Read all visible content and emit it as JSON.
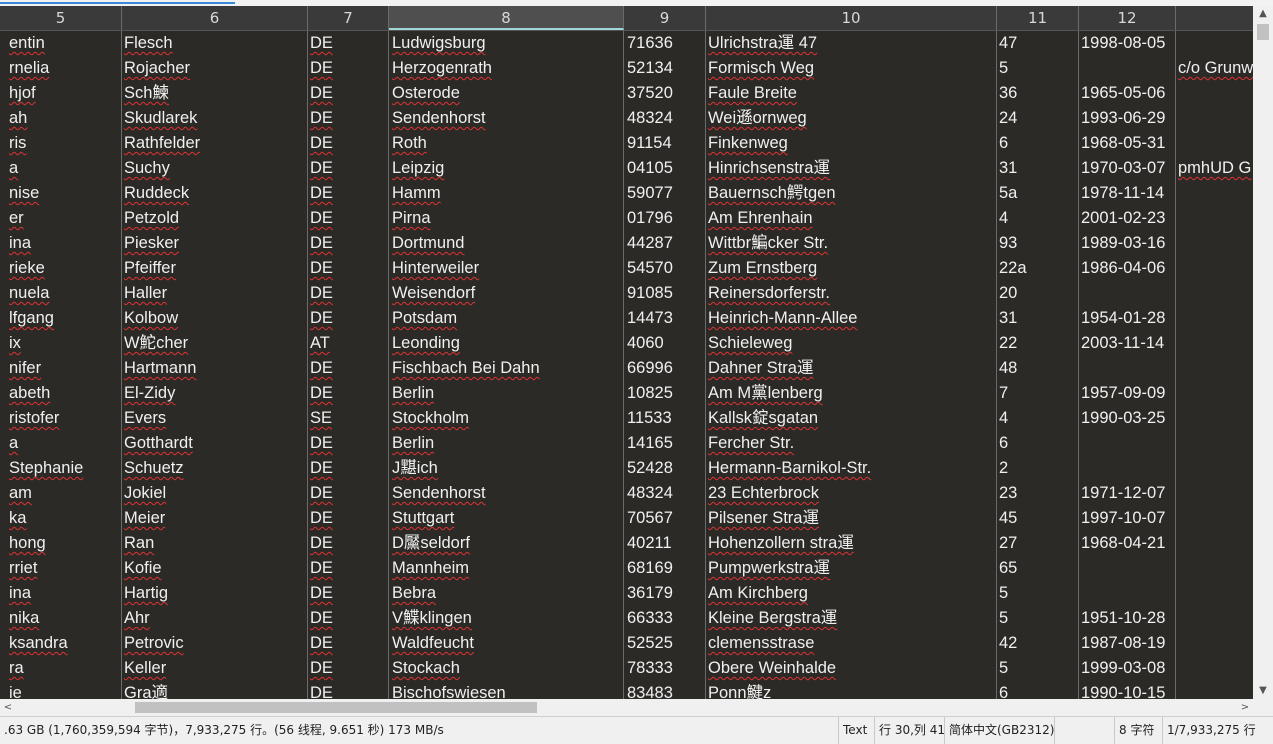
{
  "header": {
    "columns": [
      "5",
      "6",
      "7",
      "8",
      "9",
      "10",
      "11",
      "12",
      ""
    ]
  },
  "rows": [
    [
      "entin",
      "Flesch",
      "DE",
      "Ludwigsburg",
      "71636",
      "Ulrichstra運 47",
      "47",
      "1998-08-05",
      ""
    ],
    [
      "rnelia",
      "Rojacher",
      "DE",
      "Herzogenrath",
      "52134",
      "Formisch Weg",
      "5",
      "",
      "c/o Grunw"
    ],
    [
      "hjof",
      "Sch鰊",
      "DE",
      "Osterode",
      "37520",
      "Faule Breite",
      "36",
      "1965-05-06",
      ""
    ],
    [
      "ah",
      "Skudlarek",
      "DE",
      "Sendenhorst",
      "48324",
      "Wei遜ornweg",
      "24",
      "1993-06-29",
      ""
    ],
    [
      "ris",
      "Rathfelder",
      "DE",
      "Roth",
      "91154",
      "Finkenweg",
      "6",
      "1968-05-31",
      ""
    ],
    [
      "a",
      "Suchy",
      "DE",
      "Leipzig",
      "04105",
      "Hinrichsenstra運",
      "31",
      "1970-03-07",
      "pmhUD G"
    ],
    [
      "nise",
      "Ruddeck",
      "DE",
      "Hamm",
      "59077",
      "Bauernsch鰐tgen",
      "5a",
      "1978-11-14",
      ""
    ],
    [
      "er",
      "Petzold",
      "DE",
      "Pirna",
      "01796",
      "Am Ehrenhain",
      "4",
      "2001-02-23",
      ""
    ],
    [
      "ina",
      "Piesker",
      "DE",
      "Dortmund",
      "44287",
      "Wittbr鯿cker Str.",
      "93",
      "1989-03-16",
      ""
    ],
    [
      "rieke",
      "Pfeiffer",
      "DE",
      "Hinterweiler",
      "54570",
      "Zum Ernstberg",
      "22a",
      "1986-04-06",
      ""
    ],
    [
      "nuela",
      "Haller",
      "DE",
      "Weisendorf",
      "91085",
      "Reinersdorferstr.",
      "20",
      "",
      ""
    ],
    [
      "lfgang",
      "Kolbow",
      "DE",
      "Potsdam",
      "14473",
      "Heinrich-Mann-Allee",
      "31",
      "1954-01-28",
      ""
    ],
    [
      "ix",
      "W鮀cher",
      "AT",
      "Leonding",
      "4060",
      "Schieleweg",
      "22",
      "2003-11-14",
      ""
    ],
    [
      "nifer",
      "Hartmann",
      "DE",
      "Fischbach Bei Dahn",
      "66996",
      "Dahner Stra運",
      "48",
      "",
      ""
    ],
    [
      "abeth",
      "El-Zidy",
      "DE",
      "Berlin",
      "10825",
      "Am M黨lenberg",
      "7",
      "1957-09-09",
      ""
    ],
    [
      "ristofer",
      "Evers",
      "SE",
      "Stockholm",
      "11533",
      "Kallsk錠sgatan",
      "4",
      "1990-03-25",
      ""
    ],
    [
      "a",
      "Gotthardt",
      "DE",
      "Berlin",
      "14165",
      "Fercher Str.",
      "6",
      "",
      ""
    ],
    [
      " Stephanie",
      "Schuetz",
      "DE",
      "J黮ich",
      "52428",
      "Hermann-Barnikol-Str.",
      "2",
      "",
      ""
    ],
    [
      "am",
      "Jokiel",
      "DE",
      "Sendenhorst",
      "48324",
      "23 Echterbrock",
      "23",
      "1971-12-07",
      ""
    ],
    [
      "ka",
      "Meier",
      "DE",
      "Stuttgart",
      "70567",
      "Pilsener Stra運",
      "45",
      "1997-10-07",
      ""
    ],
    [
      "hong",
      "Ran",
      "DE",
      "D黶seldorf",
      "40211",
      "Hohenzollern stra運",
      "27",
      "1968-04-21",
      ""
    ],
    [
      "rriet",
      "Kofie",
      "DE",
      "Mannheim",
      "68169",
      "Pumpwerkstra運",
      "65",
      "",
      ""
    ],
    [
      "ina",
      "Hartig",
      "DE",
      "Bebra",
      "36179",
      "Am Kirchberg",
      "5",
      "",
      ""
    ],
    [
      "nika",
      "Ahr",
      "DE",
      "V鰈klingen",
      "66333",
      "Kleine Bergstra運",
      "5",
      "1951-10-28",
      ""
    ],
    [
      "ksandra",
      "Petrovic",
      "DE",
      "Waldfeucht",
      "52525",
      "clemensstrase",
      "42",
      "1987-08-19",
      ""
    ],
    [
      "ra",
      "Keller",
      "DE",
      "Stockach",
      "78333",
      "Obere Weinhalde",
      "5",
      "1999-03-08",
      ""
    ],
    [
      "ie",
      "Gra適",
      "DE",
      "Bischofswiesen",
      "83483",
      "Ponn鰎z",
      "6",
      "1990-10-15",
      ""
    ]
  ],
  "status": {
    "file_info": ".63 GB (1,760,359,594 字节)，7,933,275 行。(56 线程, 9.651 秒) 173 MB/s",
    "mode": "Text",
    "position": "行 30,列 41",
    "encoding": "简体中文(GB2312)",
    "chars": "8 字符",
    "line_count": "1/7,933,275 行"
  },
  "colors": {
    "grid_bg": "#2b2a26",
    "text": "#f0f0f0",
    "header_bg": "#3a3a3a",
    "active_header": "#4f4f4f",
    "squiggle": "#dd3333"
  }
}
